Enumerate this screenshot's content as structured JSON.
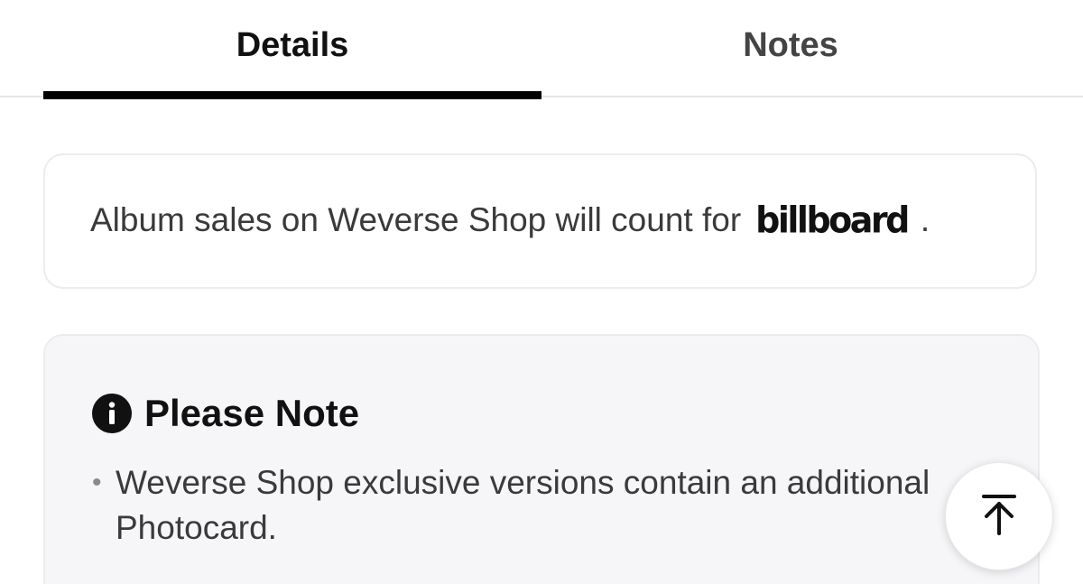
{
  "tabs": {
    "items": [
      {
        "label": "Details",
        "active": true
      },
      {
        "label": "Notes",
        "active": false
      }
    ]
  },
  "billboard_notice": {
    "text": "Album sales on Weverse Shop will count for",
    "logo_text": "billboard",
    "suffix": "."
  },
  "note": {
    "icon": "info-icon",
    "title": "Please Note",
    "items": [
      "Weverse Shop exclusive versions contain an additional Photocard."
    ]
  },
  "scroll_top": {
    "icon": "arrow-up-to-top-icon"
  },
  "colors": {
    "active_tab_underline": "#000000",
    "note_background": "#f6f6f8"
  }
}
